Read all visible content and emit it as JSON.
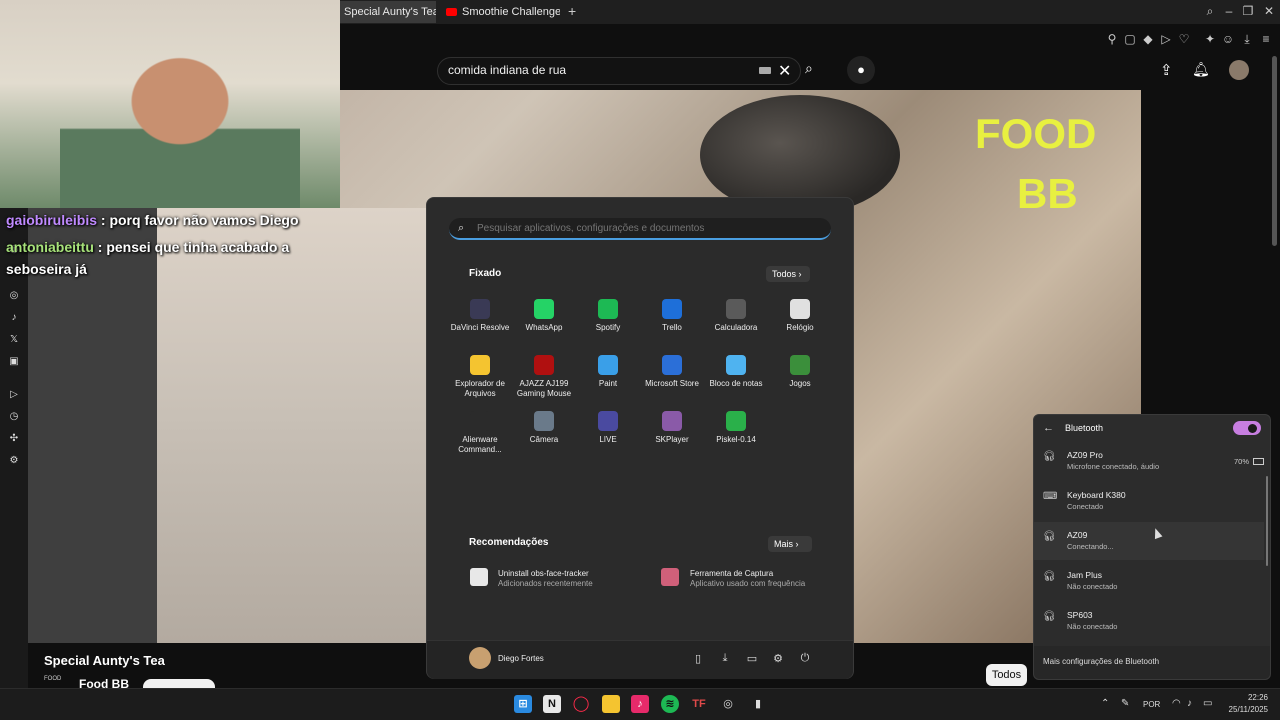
{
  "browser": {
    "tabs": [
      {
        "label": "Special Aunty's Tea - You"
      },
      {
        "label": "Smoothie Challenge! - De"
      }
    ],
    "new_tab": "+"
  },
  "youtube": {
    "search_value": "comida indiana de rua",
    "video_overlay_text_1": "FOOD",
    "video_overlay_text_2": "BB",
    "video_title": "Special Aunty's Tea",
    "channel_name": "Food BB",
    "channel_logo_text": "FOOD",
    "filter_chip": "Todos"
  },
  "chat": {
    "messages": [
      {
        "user": "gaiobiruleibis",
        "text": " : porq favor não vamos Diego"
      },
      {
        "user": "antoniabeittu",
        "text": " : pensei que tinha acabado a"
      },
      {
        "user": "",
        "text": "seboseira já"
      }
    ]
  },
  "start_menu": {
    "search_placeholder": "Pesquisar aplicativos, configurações e documentos",
    "pinned_label": "Fixado",
    "all_button": "Todos",
    "apps": [
      {
        "label": "DaVinci Resolve",
        "color": "#3a3a55"
      },
      {
        "label": "WhatsApp",
        "color": "#25d366"
      },
      {
        "label": "Spotify",
        "color": "#1db954"
      },
      {
        "label": "Trello",
        "color": "#1e6fd9"
      },
      {
        "label": "Calculadora",
        "color": "#5a5a5a"
      },
      {
        "label": "Relógio",
        "color": "#e0e0e0"
      },
      {
        "label": "Explorador de Arquivos",
        "color": "#f4c430"
      },
      {
        "label": "AJAZZ AJ199 Gaming Mouse",
        "color": "#b01010"
      },
      {
        "label": "Paint",
        "color": "#3a9fe8"
      },
      {
        "label": "Microsoft Store",
        "color": "#2b6fd8"
      },
      {
        "label": "Bloco de notas",
        "color": "#4fb3f0"
      },
      {
        "label": "Jogos",
        "color": "#3b8f3b"
      },
      {
        "label": "Alienware Command...",
        "color": "#2b2b2b"
      },
      {
        "label": "Câmera",
        "color": "#6a7a8a"
      },
      {
        "label": "LIVE",
        "color": "#4a4aa0"
      },
      {
        "label": "SKPlayer",
        "color": "#8a5aa8"
      },
      {
        "label": "Piskel-0.14",
        "color": "#2ab04a"
      }
    ],
    "recommendations_label": "Recomendações",
    "more_button": "Mais",
    "recommendations": [
      {
        "title": "Uninstall obs-face-tracker",
        "subtitle": "Adicionados recentemente"
      },
      {
        "title": "Ferramenta de Captura",
        "subtitle": "Aplicativo usado com frequência"
      }
    ],
    "user_name": "Diego Fortes"
  },
  "bluetooth": {
    "title": "Bluetooth",
    "devices": [
      {
        "name": "AZ09 Pro",
        "status": "Microfone conectado, áudio",
        "icon": "headphones-icon"
      },
      {
        "name": "Keyboard K380",
        "status": "Conectado",
        "icon": "keyboard-icon"
      },
      {
        "name": "AZ09",
        "status": "Conectando...",
        "icon": "headphones-icon"
      },
      {
        "name": "Jam Plus",
        "status": "Não conectado",
        "icon": "headphones-icon"
      },
      {
        "name": "SP603",
        "status": "Não conectado",
        "icon": "headphones-icon"
      }
    ],
    "battery": "70%",
    "more_settings": "Mais configurações de Bluetooth",
    "toggle_color": "#c77ee0"
  },
  "taskbar": {
    "language": "POR",
    "time": "22:26",
    "date": "25/11/2025"
  }
}
